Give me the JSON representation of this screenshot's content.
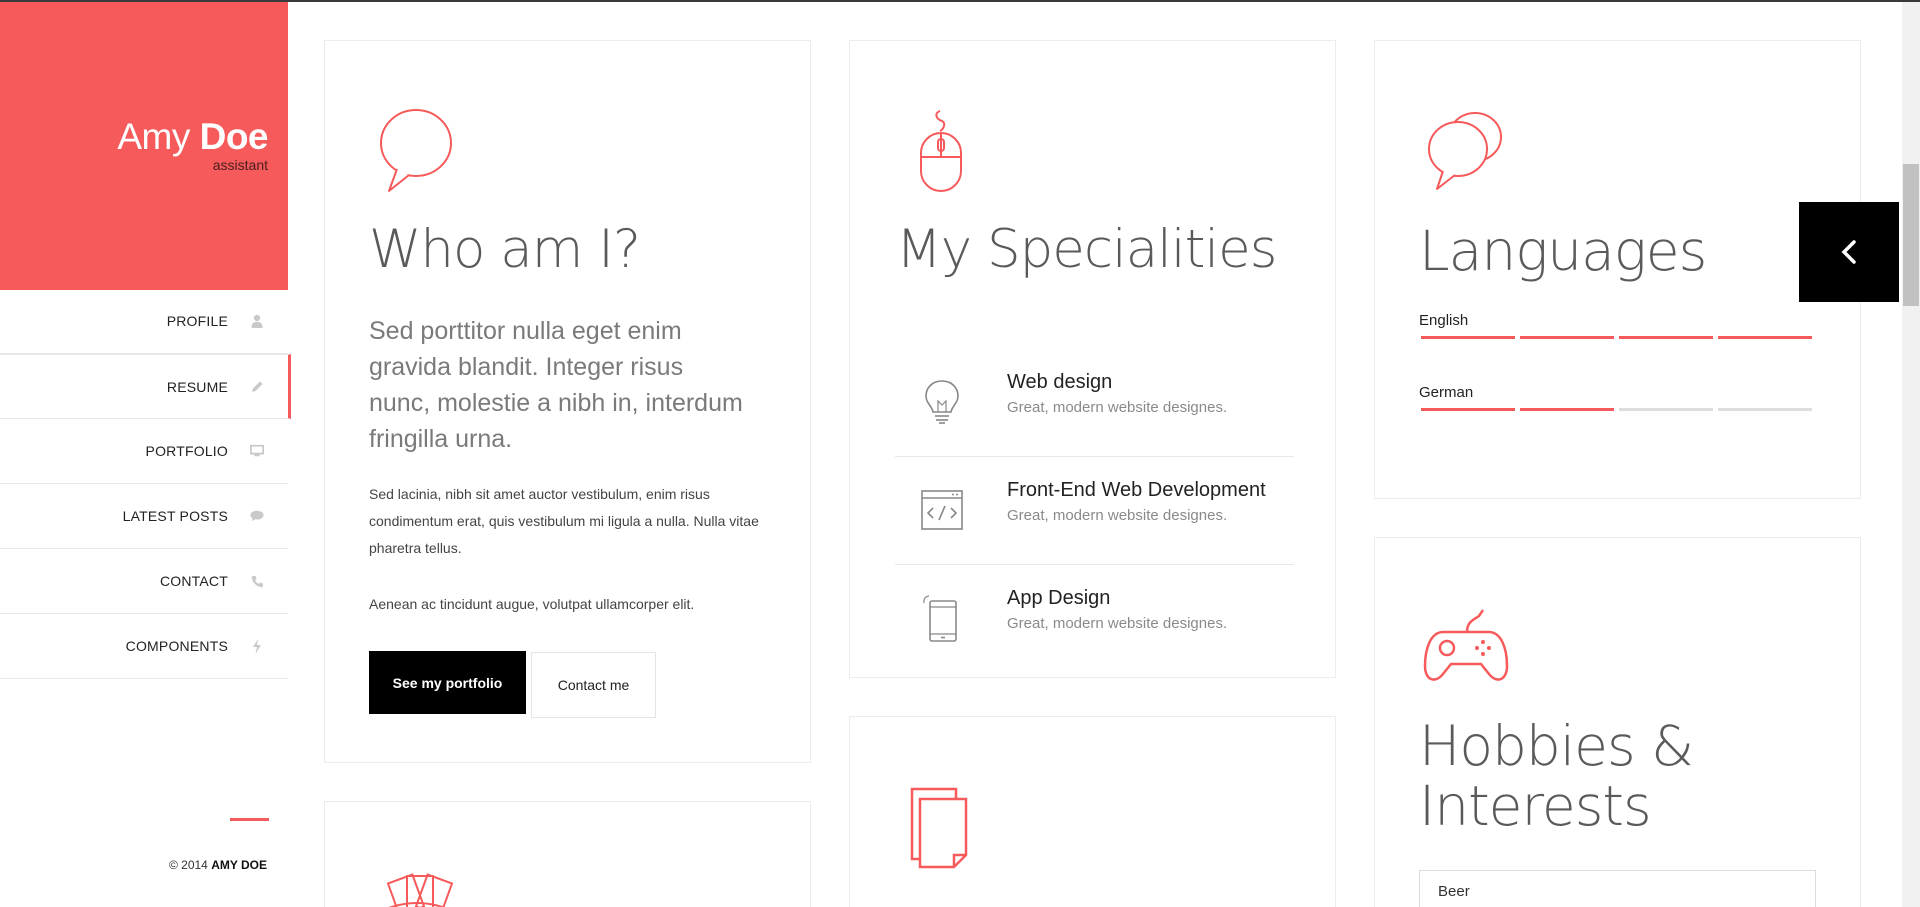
{
  "brand": {
    "first_name": "Amy",
    "last_name": "Doe",
    "role": "assistant"
  },
  "nav": {
    "items": [
      {
        "label": "PROFILE",
        "icon": "user-icon"
      },
      {
        "label": "RESUME",
        "icon": "pencil-icon",
        "active": true
      },
      {
        "label": "PORTFOLIO",
        "icon": "monitor-icon"
      },
      {
        "label": "LATEST POSTS",
        "icon": "chat-icon"
      },
      {
        "label": "CONTACT",
        "icon": "phone-icon"
      },
      {
        "label": "COMPONENTS",
        "icon": "bolt-icon"
      }
    ]
  },
  "footer": {
    "copyright_prefix": "© 2014",
    "copyright_name": "AMY DOE"
  },
  "about": {
    "title": "Who am I?",
    "lead": "Sed porttitor nulla eget enim gravida blandit. Integer risus nunc, molestie a nibh in, interdum fringilla urna.",
    "para1": "Sed lacinia, nibh sit amet auctor vestibulum, enim risus condimentum erat, quis vestibulum mi ligula a nulla. Nulla vitae pharetra tellus.",
    "para2": "Aenean ac tincidunt augue, volutpat ullamcorper elit.",
    "primary_button": "See my portfolio",
    "secondary_button": "Contact me"
  },
  "specialities": {
    "title": "My Specialities",
    "items": [
      {
        "title": "Web design",
        "desc": "Great, modern website designes.",
        "icon": "lightbulb-icon"
      },
      {
        "title": "Front-End Web Development",
        "desc": "Great, modern website designes.",
        "icon": "code-window-icon"
      },
      {
        "title": "App Design",
        "desc": "Great, modern website designes.",
        "icon": "tablet-icon"
      }
    ]
  },
  "languages": {
    "title": "Languages",
    "items": [
      {
        "name": "English",
        "level": 4,
        "max": 4
      },
      {
        "name": "German",
        "level": 2,
        "max": 4
      }
    ]
  },
  "hobbies": {
    "title": "Hobbies & Interests",
    "first_item": "Beer"
  },
  "colors": {
    "accent": "#f65a5b",
    "dark": "#000000"
  }
}
